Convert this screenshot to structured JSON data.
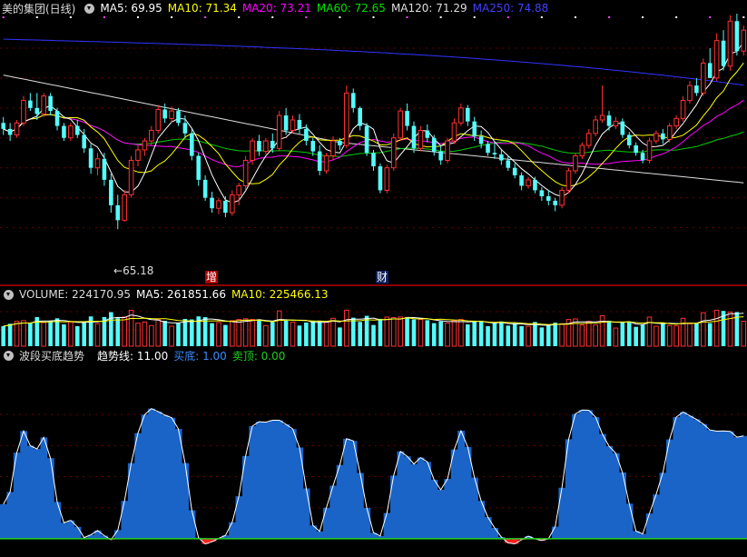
{
  "price_header": {
    "title": "美的集团(日线)",
    "ma5": "MA5: 69.95",
    "ma10": "MA10: 71.34",
    "ma20": "MA20: 73.21",
    "ma60": "MA60: 72.65",
    "ma120": "MA120: 71.29",
    "ma250": "MA250: 74.88"
  },
  "price_annotations": {
    "low_label": "65.18",
    "tag1": "增",
    "tag2": "财"
  },
  "volume_header": {
    "volume": "VOLUME: 224170.95",
    "ma5": "MA5: 261851.66",
    "ma10": "MA10: 225466.13"
  },
  "indicator_header": {
    "name": "波段买底趋势",
    "trend": "趋势线: 11.00",
    "buy": "买底: 1.00",
    "sell": "卖顶: 0.00"
  },
  "colors": {
    "up": "#ff3232",
    "down": "#54fcfc",
    "ma5": "#ffffff",
    "ma10": "#ffff00",
    "ma20": "#ff00ff",
    "ma60": "#00cc00",
    "ma120": "#dddddd",
    "ma250": "#3333ff",
    "area": "#1a64c8",
    "neg": "#ff2020"
  },
  "chart_data": {
    "type": "candlestick",
    "title": "美的集团(日线)",
    "price_ylim": [
      63,
      80
    ],
    "candles": [
      [
        73.0,
        73.4,
        72.2,
        72.6
      ],
      [
        72.6,
        73.0,
        71.8,
        72.2
      ],
      [
        72.2,
        73.2,
        72.0,
        73.0
      ],
      [
        73.0,
        74.8,
        72.8,
        74.5
      ],
      [
        74.5,
        75.0,
        73.8,
        74.0
      ],
      [
        74.0,
        75.0,
        73.2,
        73.6
      ],
      [
        73.6,
        75.0,
        73.4,
        74.8
      ],
      [
        74.8,
        75.0,
        73.5,
        73.8
      ],
      [
        73.8,
        74.0,
        72.5,
        72.8
      ],
      [
        72.8,
        73.0,
        71.8,
        72.0
      ],
      [
        72.0,
        73.0,
        71.8,
        72.8
      ],
      [
        72.8,
        73.2,
        72.0,
        72.2
      ],
      [
        72.2,
        72.6,
        71.0,
        71.3
      ],
      [
        71.3,
        71.6,
        69.6,
        70.0
      ],
      [
        70.0,
        71.0,
        69.5,
        70.6
      ],
      [
        70.6,
        71.0,
        68.8,
        69.2
      ],
      [
        69.2,
        69.6,
        67.0,
        67.5
      ],
      [
        67.5,
        68.2,
        65.9,
        66.5
      ],
      [
        66.5,
        68.5,
        66.4,
        68.2
      ],
      [
        68.2,
        70.8,
        68.0,
        70.5
      ],
      [
        70.5,
        71.5,
        70.1,
        71.2
      ],
      [
        71.2,
        72.0,
        70.8,
        71.8
      ],
      [
        71.8,
        72.8,
        71.5,
        72.5
      ],
      [
        72.5,
        74.2,
        72.3,
        73.9
      ],
      [
        73.9,
        74.3,
        73.0,
        73.3
      ],
      [
        73.3,
        74.1,
        73.0,
        73.8
      ],
      [
        73.8,
        74.0,
        72.8,
        73.0
      ],
      [
        73.0,
        73.5,
        72.0,
        72.3
      ],
      [
        72.3,
        72.6,
        70.5,
        70.8
      ],
      [
        70.8,
        71.0,
        68.8,
        69.2
      ],
      [
        69.2,
        69.5,
        67.8,
        68.0
      ],
      [
        68.0,
        68.4,
        67.0,
        67.3
      ],
      [
        67.3,
        68.0,
        66.9,
        67.8
      ],
      [
        67.8,
        68.1,
        66.7,
        67.0
      ],
      [
        67.0,
        68.5,
        66.8,
        68.2
      ],
      [
        68.2,
        69.0,
        67.5,
        68.8
      ],
      [
        68.8,
        70.8,
        68.5,
        70.5
      ],
      [
        70.5,
        72.0,
        70.2,
        71.8
      ],
      [
        71.8,
        72.2,
        70.8,
        71.1
      ],
      [
        71.1,
        72.0,
        70.9,
        71.8
      ],
      [
        71.8,
        72.3,
        71.0,
        71.3
      ],
      [
        71.3,
        73.8,
        71.1,
        73.5
      ],
      [
        73.5,
        74.0,
        72.2,
        72.5
      ],
      [
        72.5,
        73.5,
        72.3,
        73.2
      ],
      [
        73.2,
        73.6,
        72.3,
        72.6
      ],
      [
        72.6,
        72.9,
        71.5,
        71.8
      ],
      [
        71.8,
        72.0,
        70.8,
        71.1
      ],
      [
        71.1,
        71.5,
        69.5,
        69.8
      ],
      [
        69.8,
        71.0,
        69.6,
        70.8
      ],
      [
        70.8,
        72.1,
        70.5,
        71.8
      ],
      [
        71.8,
        72.0,
        71.2,
        71.5
      ],
      [
        71.5,
        75.5,
        71.3,
        75.0
      ],
      [
        75.0,
        75.3,
        73.7,
        74.0
      ],
      [
        74.0,
        74.1,
        72.5,
        72.8
      ],
      [
        72.8,
        73.0,
        70.8,
        71.0
      ],
      [
        71.0,
        71.2,
        69.8,
        70.1
      ],
      [
        70.1,
        70.3,
        68.3,
        68.5
      ],
      [
        68.5,
        70.2,
        68.3,
        70.0
      ],
      [
        70.0,
        72.3,
        69.8,
        72.0
      ],
      [
        72.0,
        74.0,
        71.8,
        73.8
      ],
      [
        73.8,
        74.3,
        72.5,
        72.8
      ],
      [
        72.8,
        73.1,
        71.0,
        71.3
      ],
      [
        71.3,
        72.8,
        71.1,
        72.5
      ],
      [
        72.5,
        72.9,
        71.7,
        72.0
      ],
      [
        72.0,
        72.2,
        70.8,
        71.1
      ],
      [
        71.1,
        71.5,
        70.2,
        70.5
      ],
      [
        70.5,
        72.0,
        70.3,
        71.8
      ],
      [
        71.8,
        73.3,
        71.6,
        73.0
      ],
      [
        73.0,
        74.3,
        72.8,
        74.0
      ],
      [
        74.0,
        74.2,
        72.8,
        73.1
      ],
      [
        73.1,
        73.4,
        71.8,
        72.1
      ],
      [
        72.1,
        72.5,
        71.3,
        71.6
      ],
      [
        71.6,
        71.8,
        70.8,
        71.0
      ],
      [
        71.0,
        71.7,
        70.6,
        70.9
      ],
      [
        70.9,
        71.2,
        70.2,
        70.5
      ],
      [
        70.5,
        70.8,
        69.8,
        70.0
      ],
      [
        70.0,
        70.3,
        69.3,
        69.5
      ],
      [
        69.5,
        69.7,
        68.5,
        68.8
      ],
      [
        68.8,
        69.4,
        68.6,
        69.2
      ],
      [
        69.2,
        69.4,
        68.3,
        68.5
      ],
      [
        68.5,
        68.7,
        67.8,
        68.1
      ],
      [
        68.1,
        68.5,
        67.5,
        67.8
      ],
      [
        67.8,
        68.0,
        67.1,
        67.5
      ],
      [
        67.5,
        68.7,
        67.3,
        68.5
      ],
      [
        68.5,
        70.0,
        68.3,
        69.8
      ],
      [
        69.8,
        71.0,
        69.6,
        70.8
      ],
      [
        70.8,
        71.7,
        70.6,
        71.5
      ],
      [
        71.5,
        72.6,
        71.3,
        72.3
      ],
      [
        72.3,
        73.5,
        72.1,
        73.2
      ],
      [
        73.2,
        75.5,
        73.0,
        73.5
      ],
      [
        73.5,
        73.8,
        72.5,
        72.8
      ],
      [
        72.8,
        73.4,
        72.6,
        73.1
      ],
      [
        73.1,
        73.3,
        72.0,
        72.2
      ],
      [
        72.2,
        72.4,
        71.3,
        71.5
      ],
      [
        71.5,
        71.7,
        70.8,
        71.0
      ],
      [
        71.0,
        71.2,
        70.3,
        70.5
      ],
      [
        70.5,
        72.0,
        70.3,
        71.8
      ],
      [
        71.8,
        72.5,
        71.6,
        72.3
      ],
      [
        72.3,
        72.6,
        71.6,
        71.9
      ],
      [
        71.9,
        73.0,
        71.7,
        72.8
      ],
      [
        72.8,
        73.5,
        72.6,
        73.3
      ],
      [
        73.3,
        74.8,
        73.1,
        74.5
      ],
      [
        74.5,
        75.8,
        74.3,
        75.5
      ],
      [
        75.5,
        76.0,
        74.8,
        75.0
      ],
      [
        75.0,
        77.3,
        74.8,
        77.0
      ],
      [
        77.0,
        78.0,
        76.5,
        76.0
      ],
      [
        76.0,
        79.0,
        75.8,
        78.5
      ],
      [
        78.5,
        79.2,
        76.5,
        76.8
      ],
      [
        76.8,
        80.2,
        76.5,
        79.8
      ],
      [
        79.8,
        80.3,
        77.5,
        77.8
      ],
      [
        77.8,
        79.5,
        77.5,
        79.2
      ]
    ],
    "volume": {
      "header_value": 224170.95,
      "ma5": 261851.66,
      "ma10": 225466.13
    },
    "indicator": {
      "name": "波段买底趋势",
      "trend_value": 11.0,
      "buy_value": 1.0,
      "sell_value": 0.0,
      "ylim": [
        -4,
        40
      ]
    },
    "low_annotation": 65.18
  }
}
